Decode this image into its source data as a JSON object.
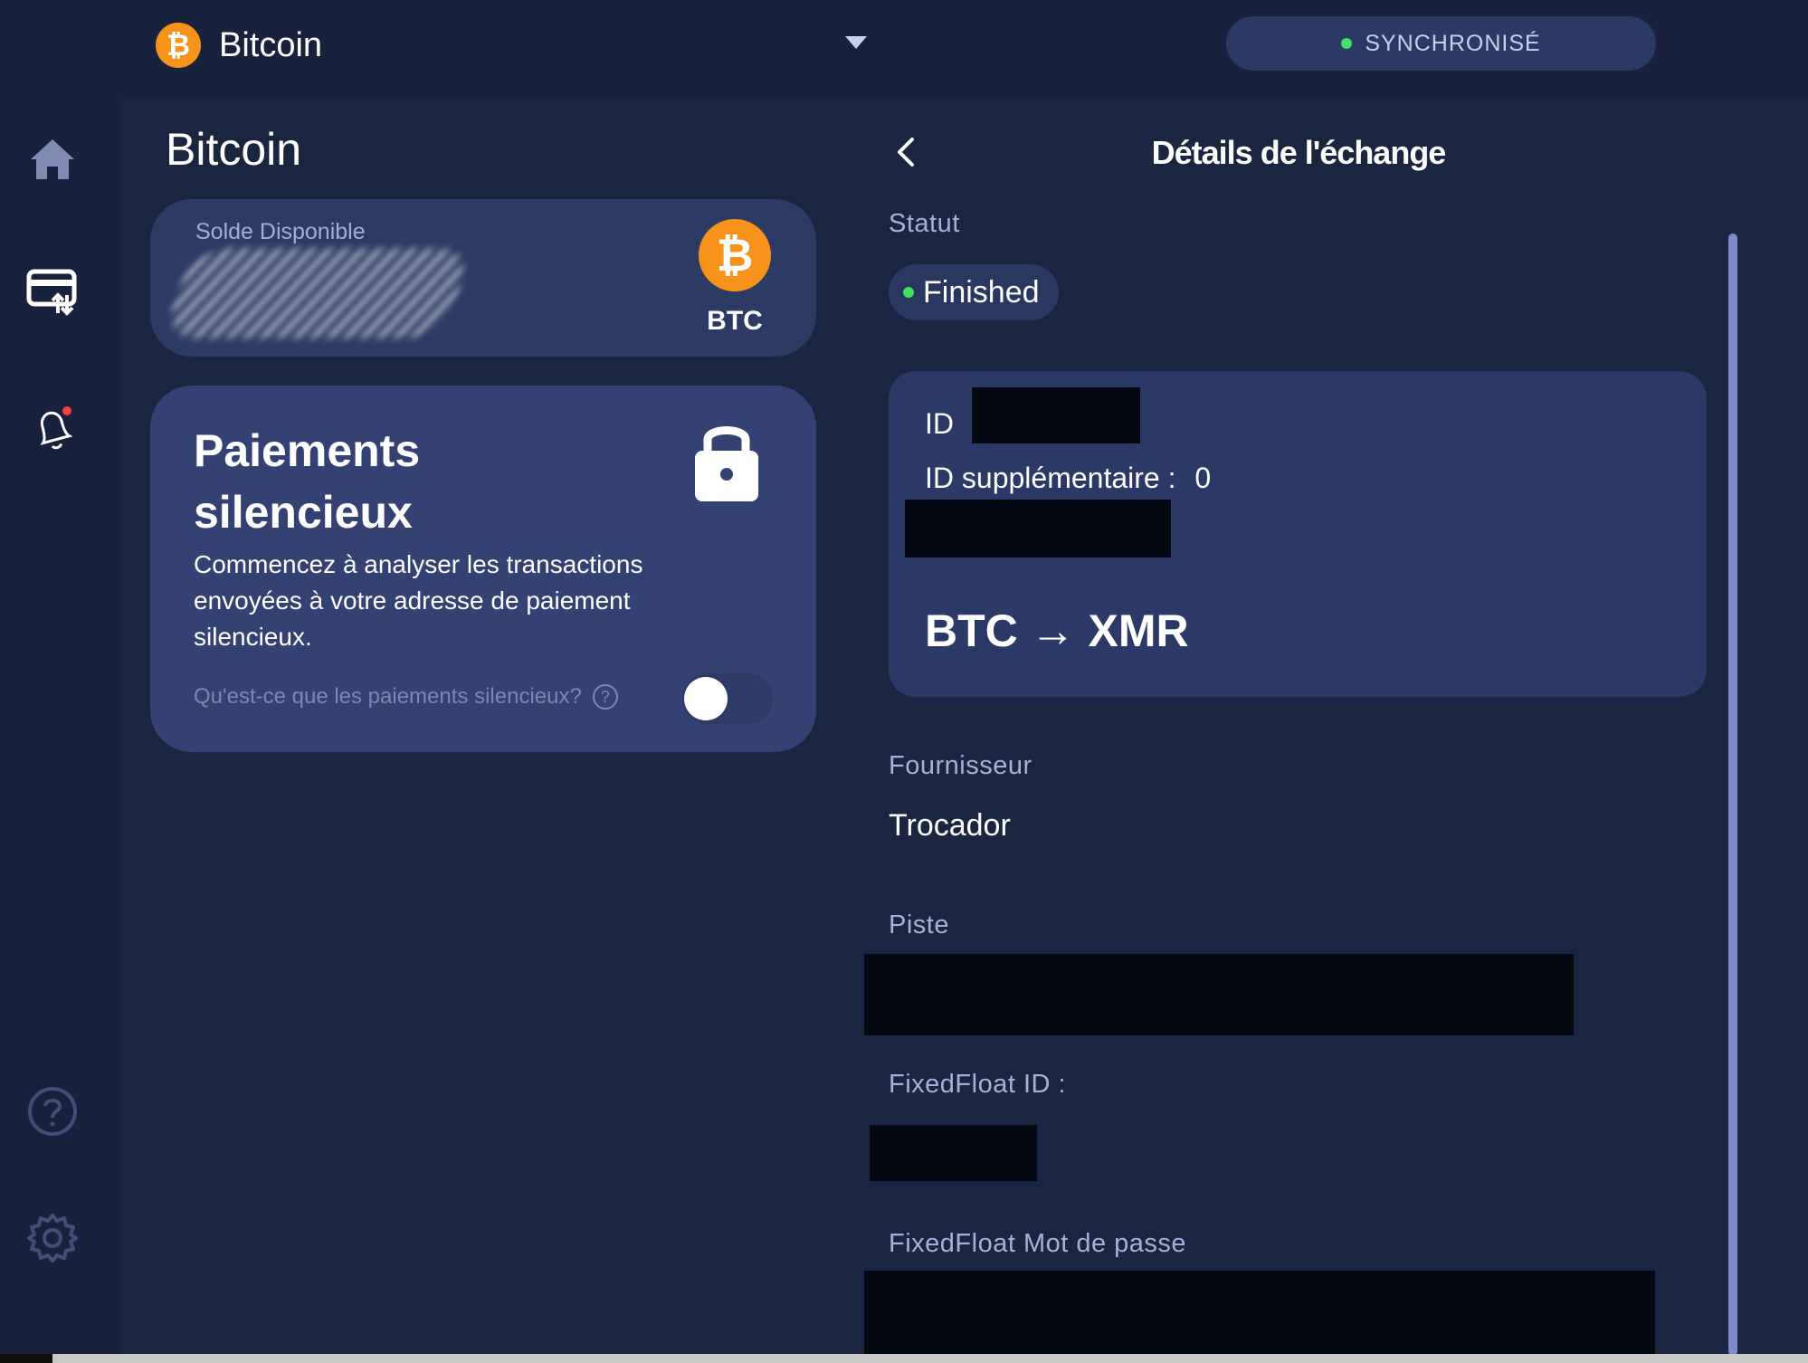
{
  "header": {
    "wallet_name": "Bitcoin",
    "coin_glyph": "₿",
    "sync_status": "SYNCHRONISÉ",
    "sync_color": "#3fe05a"
  },
  "sidebar": {
    "items": [
      {
        "icon": "home-icon"
      },
      {
        "icon": "wallet-transfer-icon"
      },
      {
        "icon": "bell-icon",
        "has_notification": true
      },
      {
        "icon": "help-icon"
      },
      {
        "icon": "gear-icon"
      }
    ]
  },
  "wallet": {
    "title": "Bitcoin",
    "balance_label": "Solde Disponible",
    "coin_glyph": "₿",
    "ticker": "BTC",
    "accent_color": "#f7931a"
  },
  "silent_payments": {
    "title": "Paiements silencieux",
    "description": "Commencez à analyser les transactions envoyées à votre adresse de paiement silencieux.",
    "help_link": "Qu'est-ce que les paiements silencieux?",
    "help_glyph": "?",
    "enabled": false
  },
  "exchange": {
    "title": "Détails de l'échange",
    "status_label": "Statut",
    "status_value": "Finished",
    "id_label": "ID",
    "extra_id_label": "ID supplémentaire :",
    "extra_id_value": "0",
    "pair": "BTC → XMR",
    "provider_label": "Fournisseur",
    "provider_value": "Trocador",
    "track_label": "Piste",
    "fixedfloat_id_label": "FixedFloat ID :",
    "fixedfloat_password_label": "FixedFloat Mot de passe"
  }
}
